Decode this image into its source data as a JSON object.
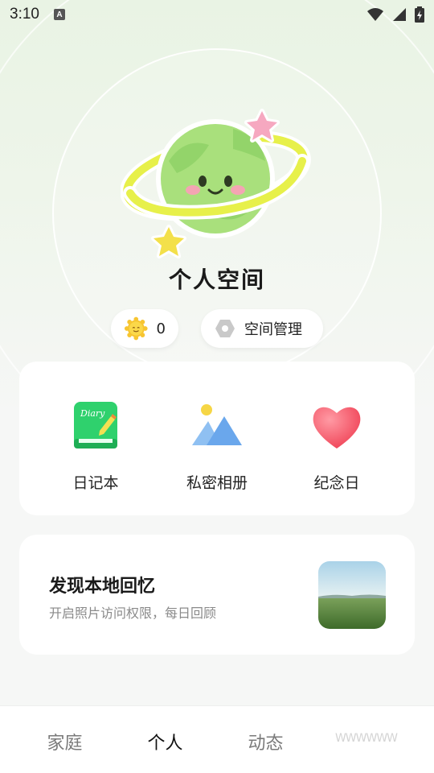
{
  "status_bar": {
    "time": "3:10",
    "notification_letter": "A",
    "icons": [
      "wifi-icon",
      "signal-icon",
      "battery-icon"
    ]
  },
  "hero": {
    "title": "个人空间",
    "coin_count": "0",
    "manage_label": "空间管理"
  },
  "features": [
    {
      "label": "日记本",
      "icon": "diary-icon",
      "badge_text": "Diary"
    },
    {
      "label": "私密相册",
      "icon": "album-icon"
    },
    {
      "label": "纪念日",
      "icon": "heart-icon"
    }
  ],
  "memory_card": {
    "title": "发现本地回忆",
    "subtitle": "开启照片访问权限，每日回顾"
  },
  "bottom_nav": {
    "items": [
      "家庭",
      "个人",
      "动态",
      "WWWWWW"
    ],
    "active_index": 1
  },
  "colors": {
    "accent_green": "#3fcf6e",
    "planet_green": "#a8e07a",
    "ring_yellow": "#e4f24a",
    "heart_red": "#f24b5a",
    "album_blue": "#7ab2ef"
  }
}
